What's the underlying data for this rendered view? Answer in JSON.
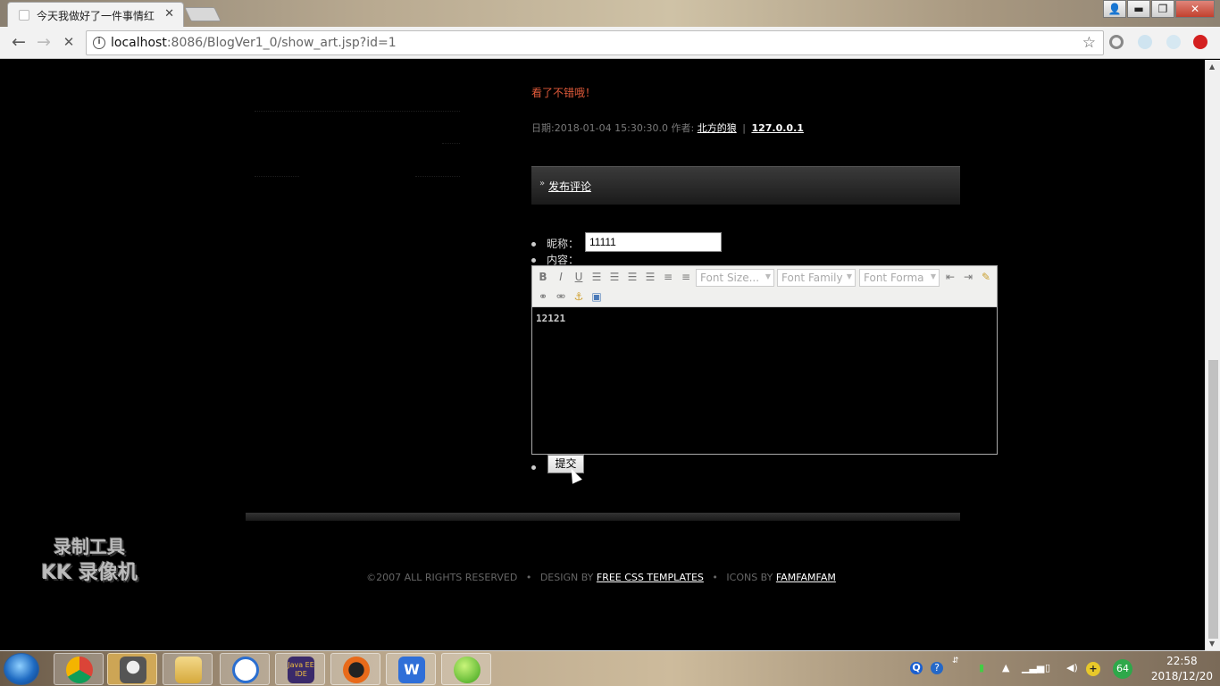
{
  "browser": {
    "tab_title": "今天我做好了一件事情红",
    "tab_close": "✕",
    "url_host": "localhost",
    "url_path": ":8086/BlogVer1_0/show_art.jsp?id=1",
    "window_buttons": {
      "user": "👤",
      "minimize": "▬",
      "maximize": "❐",
      "close": "✕"
    },
    "nav": {
      "back": "←",
      "forward": "→",
      "reload": "✕"
    },
    "star": "☆"
  },
  "page": {
    "comment_text": "看了不错哦！",
    "meta": {
      "date_label": "日期:2018-01-04 15:30:30.0 作者:",
      "author": "北方的狼",
      "separator": "|",
      "ip": "127.0.0.1"
    },
    "section_title": "发布评论",
    "form": {
      "nickname_label": "昵称：",
      "nickname_value": "11111",
      "content_label": "内容：",
      "editor": {
        "font_size": "Font Size...",
        "font_family": "Font Family",
        "font_format": "Font Forma",
        "bold": "B",
        "italic": "I",
        "underline": "U",
        "content": "12121"
      },
      "submit_label": "提交"
    },
    "footer": {
      "copyright": "©2007 ALL RIGHTS RESERVED",
      "design_by": "DESIGN BY",
      "design_link": "FREE CSS TEMPLATES",
      "icons_by": "ICONS BY",
      "icons_link": "FAMFAMFAM",
      "bullet": "•"
    },
    "watermark": {
      "line1": "录制工具",
      "line2": "KK 录像机"
    }
  },
  "taskbar": {
    "time": "22:58",
    "date": "2018/12/20",
    "badge": "64",
    "apps": [
      "chrome",
      "user",
      "files",
      "baidu-netdisk",
      "java-ee-ide",
      "app-mask",
      "wps",
      "app-green"
    ],
    "app_label_java": "Java EE IDE"
  },
  "colors": {
    "accent_comment": "#e05a3a",
    "page_bg": "#000000",
    "link": "#ffffff"
  }
}
